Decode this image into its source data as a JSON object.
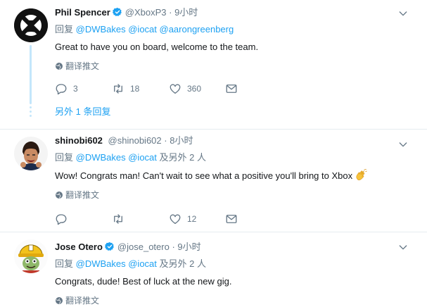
{
  "tweets": [
    {
      "name": "Phil Spencer",
      "verified": true,
      "handle": "@XboxP3",
      "separator": "·",
      "time": "9小时",
      "reply_prefix": "回复",
      "reply_to": "@DWBakes @iocat @aarongreenberg",
      "reply_suffix": "",
      "text": "Great to have you on board, welcome to the team.",
      "translate": "翻译推文",
      "actions": {
        "replies": "3",
        "retweets": "18",
        "likes": "360"
      },
      "show_more": "另外 1 条回复",
      "avatar_icon": "xbox-logo-icon"
    },
    {
      "name": "shinobi602",
      "verified": false,
      "handle": "@shinobi602",
      "separator": "·",
      "time": "8小时",
      "reply_prefix": "回复",
      "reply_to": "@DWBakes @iocat",
      "reply_suffix": "及另外 2 人",
      "text": "Wow! Congrats man! Can't wait to see what a positive you'll bring to Xbox",
      "emoji": "clapping-hands-emoji",
      "translate": "翻译推文",
      "actions": {
        "replies": "",
        "retweets": "",
        "likes": "12"
      }
    },
    {
      "name": "Jose Otero",
      "verified": true,
      "handle": "@jose_otero",
      "separator": "·",
      "time": "9小时",
      "reply_prefix": "回复",
      "reply_to": "@DWBakes @iocat",
      "reply_suffix": "及另外 2 人",
      "text": "Congrats, dude! Best of luck at the new gig.",
      "translate": "翻译推文"
    }
  ],
  "colors": {
    "accent": "#1da1f2",
    "secondary_text": "#657786",
    "thread_line": "#c4e6fb",
    "divider": "#e6ecf0"
  }
}
